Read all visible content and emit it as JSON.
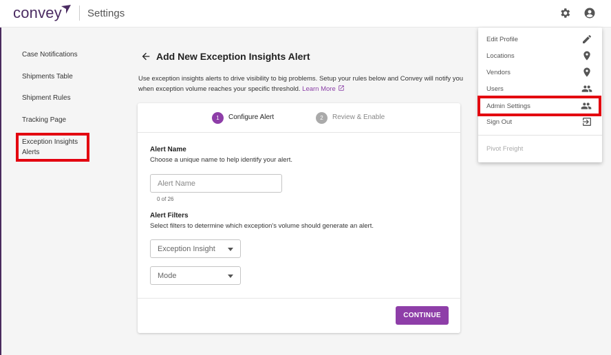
{
  "header": {
    "logo": "convey",
    "title": "Settings"
  },
  "sidebar": {
    "items": [
      {
        "label": "Case Notifications"
      },
      {
        "label": "Shipments Table"
      },
      {
        "label": "Shipment Rules"
      },
      {
        "label": "Tracking Page"
      },
      {
        "label": "Exception Insights Alerts"
      }
    ]
  },
  "main": {
    "title": "Add New Exception Insights Alert",
    "description": "Use exception insights alerts to drive visibility to big problems. Setup your rules below and Convey will notify you when exception volume reaches your specific threshold.",
    "learn_more": "Learn More",
    "steps": [
      {
        "number": "1",
        "label": "Configure Alert"
      },
      {
        "number": "2",
        "label": "Review & Enable"
      }
    ],
    "alert_name": {
      "title": "Alert Name",
      "help": "Choose a unique name to help identify your alert.",
      "placeholder": "Alert Name",
      "value": "",
      "count": "0 of 26"
    },
    "alert_filters": {
      "title": "Alert Filters",
      "help": "Select filters to determine which exception's volume should generate an alert.",
      "exception_insight": "Exception Insight",
      "mode": "Mode"
    },
    "continue_label": "CONTINUE"
  },
  "menu": {
    "items": [
      {
        "label": "Edit Profile",
        "icon": "pencil-icon"
      },
      {
        "label": "Locations",
        "icon": "location-pin-icon"
      },
      {
        "label": "Vendors",
        "icon": "location-pin-icon"
      },
      {
        "label": "Users",
        "icon": "people-icon"
      },
      {
        "label": "Admin Settings",
        "icon": "people-icon"
      },
      {
        "label": "Sign Out",
        "icon": "sign-out-icon"
      }
    ],
    "footer": "Pivot Freight"
  },
  "colors": {
    "brand": "#4b2c62",
    "accent": "#8e3ea8",
    "highlight": "#e3000f"
  }
}
